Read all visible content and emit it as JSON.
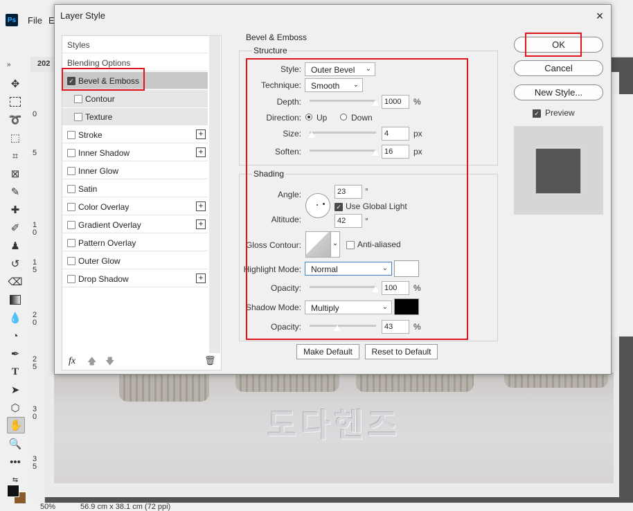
{
  "app": {
    "logo": "Ps",
    "menu": [
      "File",
      "E"
    ],
    "doc_tab": "202",
    "ruler_numbers": [
      "0",
      "5",
      "1\n0",
      "1\n5",
      "2\n0",
      "2\n5",
      "3\n0",
      "3\n5"
    ],
    "status_zoom": "50%",
    "status_size": "56.9 cm x 38.1 cm (72 ppi)",
    "photo_text": "도다헨즈"
  },
  "dialog": {
    "title": "Layer Style",
    "close": "×"
  },
  "styles_list": {
    "header_styles": "Styles",
    "header_blending": "Blending Options",
    "items": [
      {
        "label": "Bevel & Emboss",
        "checked": true,
        "plus": false
      },
      {
        "label": "Contour",
        "checked": false,
        "plus": false
      },
      {
        "label": "Texture",
        "checked": false,
        "plus": false
      },
      {
        "label": "Stroke",
        "checked": false,
        "plus": true
      },
      {
        "label": "Inner Shadow",
        "checked": false,
        "plus": true
      },
      {
        "label": "Inner Glow",
        "checked": false,
        "plus": false
      },
      {
        "label": "Satin",
        "checked": false,
        "plus": false
      },
      {
        "label": "Color Overlay",
        "checked": false,
        "plus": true
      },
      {
        "label": "Gradient Overlay",
        "checked": false,
        "plus": true
      },
      {
        "label": "Pattern Overlay",
        "checked": false,
        "plus": false
      },
      {
        "label": "Outer Glow",
        "checked": false,
        "plus": false
      },
      {
        "label": "Drop Shadow",
        "checked": false,
        "plus": true
      }
    ],
    "footer_fx": "fx"
  },
  "bevel": {
    "section_title": "Bevel & Emboss",
    "structure_title": "Structure",
    "style_label": "Style:",
    "style_value": "Outer Bevel",
    "technique_label": "Technique:",
    "technique_value": "Smooth",
    "depth_label": "Depth:",
    "depth_value": "1000",
    "depth_unit": "%",
    "direction_label": "Direction:",
    "direction_up": "Up",
    "direction_down": "Down",
    "size_label": "Size:",
    "size_value": "4",
    "size_unit": "px",
    "soften_label": "Soften:",
    "soften_value": "16",
    "soften_unit": "px",
    "shading_title": "Shading",
    "angle_label": "Angle:",
    "angle_value": "23",
    "angle_unit": "°",
    "global_light_label": "Use Global Light",
    "altitude_label": "Altitude:",
    "altitude_value": "42",
    "altitude_unit": "°",
    "gloss_label": "Gloss Contour:",
    "anti_aliased_label": "Anti-aliased",
    "highlight_label": "Highlight Mode:",
    "highlight_value": "Normal",
    "highlight_color": "#ffffff",
    "highlight_opacity_label": "Opacity:",
    "highlight_opacity_value": "100",
    "highlight_opacity_unit": "%",
    "shadow_label": "Shadow Mode:",
    "shadow_value": "Multiply",
    "shadow_color": "#000000",
    "shadow_opacity_label": "Opacity:",
    "shadow_opacity_value": "43",
    "shadow_opacity_unit": "%",
    "make_default": "Make Default",
    "reset_default": "Reset to Default"
  },
  "right": {
    "ok": "OK",
    "cancel": "Cancel",
    "new_style": "New Style...",
    "preview_label": "Preview"
  },
  "colors": {
    "highlight_red": "#e0131a",
    "preview_swatch": "#555555"
  }
}
